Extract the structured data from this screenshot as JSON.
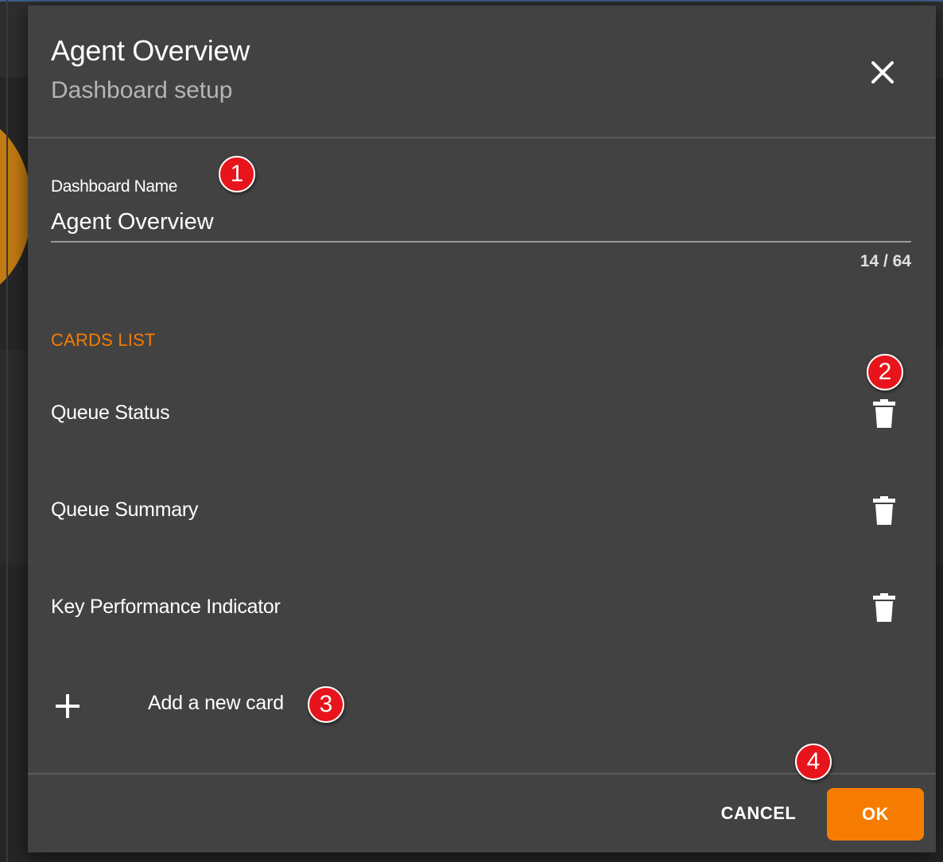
{
  "dialog": {
    "title": "Agent Overview",
    "subtitle": "Dashboard setup",
    "close_icon": "close-icon"
  },
  "dashboard_name": {
    "label": "Dashboard Name",
    "value": "Agent Overview",
    "counter": "14 / 64"
  },
  "cards_list": {
    "header": "CARDS LIST",
    "items": [
      {
        "label": "Queue Status",
        "icon": "trash-icon"
      },
      {
        "label": "Queue Summary",
        "icon": "trash-icon"
      },
      {
        "label": "Key Performance Indicator",
        "icon": "trash-icon"
      }
    ],
    "add_label": "Add a new card",
    "add_icon": "plus-icon"
  },
  "footer": {
    "cancel_label": "CANCEL",
    "ok_label": "OK"
  },
  "callouts": [
    "1",
    "2",
    "3",
    "4"
  ],
  "colors": {
    "accent": "#f57c00",
    "dialog_bg": "#424242",
    "callout": "#e8141b"
  }
}
